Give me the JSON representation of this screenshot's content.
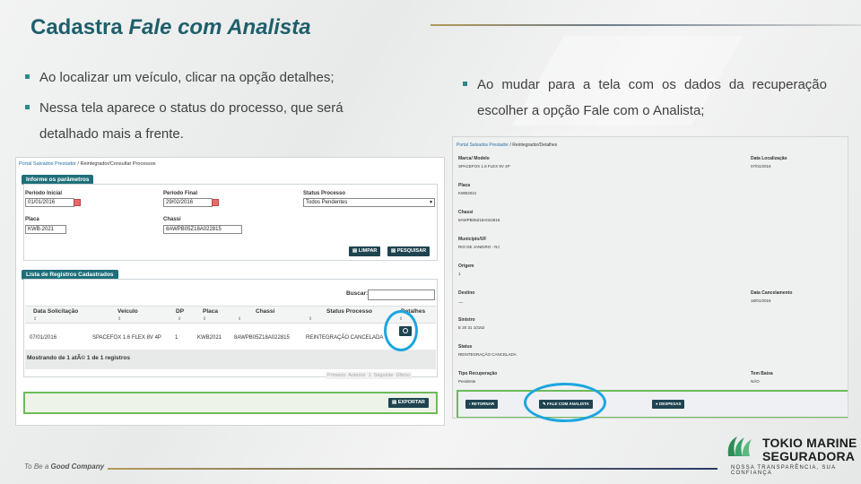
{
  "slide": {
    "title_main": "Cadastra ",
    "title_italic": "Fale com Analista",
    "bullets_left": [
      "Ao localizar um veículo,  clicar na opção detalhes;",
      "Nessa tela aparece o status do processo, que será detalhado mais a frente."
    ],
    "bullets_right": [
      "Ao mudar para a tela com os dados da recuperação escolher a opção Fale com o Analista;"
    ]
  },
  "left_screen": {
    "breadcrumb_link": "Portal Salvados Prestador",
    "breadcrumb_rest": " / Reintegrador/Consultar Processos",
    "params_title": "Informe os parâmetros",
    "periodo_inicial_label": "Período Inicial",
    "periodo_inicial_value": "01/01/2016",
    "periodo_final_label": "Período Final",
    "periodo_final_value": "29/02/2016",
    "status_label": "Status Processo",
    "status_value": "Todos Pendentes",
    "placa_label": "Placa",
    "placa_value": "KWB-2021",
    "chassi_label": "Chassi",
    "chassi_value": "8AWPB05Z18A022815",
    "limpar_label": "LIMPAR",
    "pesquisar_label": "PESQUISAR",
    "list_title": "Lista de Registros Cadastrados",
    "buscar_label": "Buscar:",
    "columns": [
      "Data Solicitação",
      "Veículo",
      "DP",
      "Placa",
      "Chassi",
      "Status Processo",
      "Detalhes"
    ],
    "sort_glyph": "⇕",
    "row": [
      "07/01/2016",
      "SPACEFOX 1.6 FLEX 8V 4P",
      "1",
      "KWB2021",
      "8AWPB05Z18A022815",
      "REINTEGRAÇÃO CANCELADA"
    ],
    "mostrando": "Mostrando de 1 atÃ© 1 de 1 registros",
    "pager": [
      "Primeiro",
      "Anterior",
      "1",
      "Seguinte",
      "Último"
    ],
    "exportar_label": "EXPORTAR"
  },
  "right_screen": {
    "breadcrumb_link": "Portal Salvados Prestador",
    "breadcrumb_rest": " / Reintegrador/Detalhes",
    "fields": [
      {
        "label": "Marca/ Modelo",
        "value": "SPACEFOX 1.6 FLEX 8V 4P"
      },
      {
        "label": "Placa",
        "value": "KWB2021"
      },
      {
        "label": "Chassi",
        "value": "8AWPB05Z18A022815"
      },
      {
        "label": "Município/UF",
        "value": "RIO DE JANEIRO - RJ"
      },
      {
        "label": "Origem",
        "value": "1"
      },
      {
        "label": "Destino",
        "value": "__"
      },
      {
        "label": "Sinistro",
        "value": "E 20 31 10162"
      },
      {
        "label": "Status",
        "value": "REINTEGRAÇÃO CANCELADA"
      },
      {
        "label": "Tipo Recuperação",
        "value": "Pendente"
      }
    ],
    "fields_right": [
      {
        "label": "Data Localização",
        "value": "07/01/2016"
      },
      {
        "label": "Data Cancelamento",
        "value": "18/01/2016"
      },
      {
        "label": "Tem Baixa",
        "value": "NÃO"
      }
    ],
    "retornar_label": "RETORNAR",
    "fale_label": "FALE COM ANALISTA",
    "despesas_label": "DESPESAS"
  },
  "footer": {
    "tagline_pre": "To Be a ",
    "tagline_bold": "Good Company",
    "logo_line1": "TOKIO MARINE",
    "logo_line2": "SEGURADORA",
    "logo_tagline": "NOSSA TRANSPARÊNCIA, SUA CONFIANÇA"
  },
  "colors": {
    "title": "#1f5f6b",
    "highlight_circle": "#1aa6e0",
    "highlight_box": "#6dbb5a",
    "button_dark": "#1e4450",
    "logo_green": "#2e8b57"
  }
}
